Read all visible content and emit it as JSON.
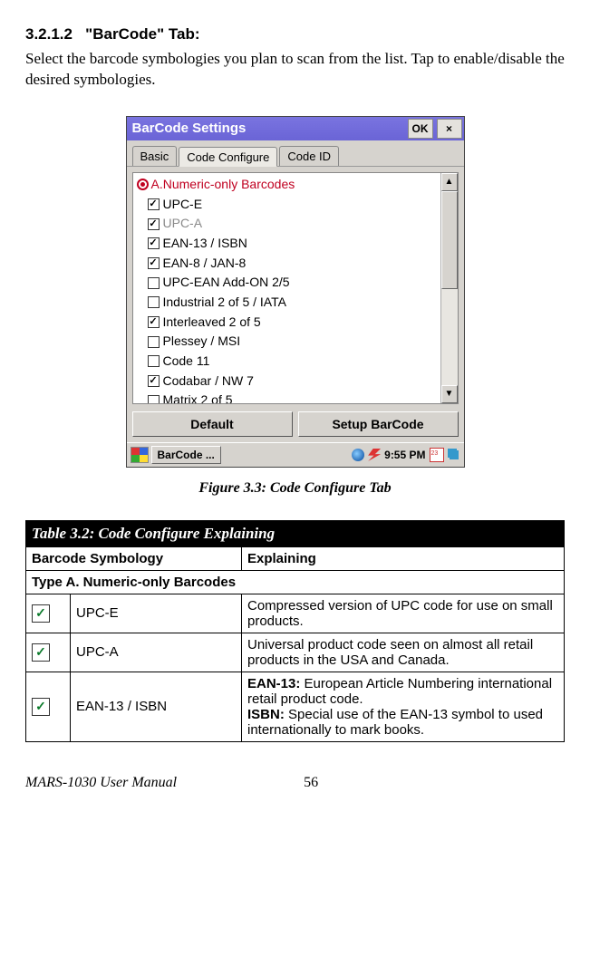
{
  "section": {
    "number": "3.2.1.2",
    "title": "\"BarCode\" Tab:",
    "body": "Select the barcode symbologies you plan to scan from the list. Tap to enable/disable the desired symbologies."
  },
  "screenshot": {
    "window_title": "BarCode Settings",
    "ok_label": "OK",
    "close_label": "×",
    "tabs": {
      "basic": "Basic",
      "code_configure": "Code Configure",
      "code_id": "Code ID"
    },
    "group_label": "A.Numeric-only Barcodes",
    "items": [
      {
        "label": "UPC-E",
        "checked": true,
        "disabled": false
      },
      {
        "label": "UPC-A",
        "checked": true,
        "disabled": true
      },
      {
        "label": "EAN-13 / ISBN",
        "checked": true,
        "disabled": false
      },
      {
        "label": "EAN-8 / JAN-8",
        "checked": true,
        "disabled": false
      },
      {
        "label": "UPC-EAN Add-ON 2/5",
        "checked": false,
        "disabled": false
      },
      {
        "label": "Industrial 2 of 5 / IATA",
        "checked": false,
        "disabled": false
      },
      {
        "label": "Interleaved 2 of 5",
        "checked": true,
        "disabled": false
      },
      {
        "label": "Plessey / MSI",
        "checked": false,
        "disabled": false
      },
      {
        "label": "Code 11",
        "checked": false,
        "disabled": false
      },
      {
        "label": "Codabar / NW 7",
        "checked": true,
        "disabled": false
      },
      {
        "label": "Matrix 2 of 5",
        "checked": false,
        "disabled": false
      }
    ],
    "buttons": {
      "default": "Default",
      "setup": "Setup BarCode"
    },
    "taskbar": {
      "app": "BarCode ...",
      "time": "9:55 PM"
    }
  },
  "figure_caption": "Figure 3.3: Code Configure Tab",
  "table": {
    "title": "Table 3.2: Code Configure Explaining",
    "headers": {
      "col1": "Barcode Symbology",
      "col2": "Explaining"
    },
    "type_row": "Type A. Numeric-only Barcodes",
    "rows": [
      {
        "name": "UPC-E",
        "explain": "Compressed version of UPC code for use on small products."
      },
      {
        "name": "UPC-A",
        "explain": "Universal product code seen on almost all retail products in the USA and Canada."
      },
      {
        "name": "EAN-13 / ISBN",
        "ean_label": "EAN-13:",
        "ean_text": " European Article Numbering international retail product code.",
        "isbn_label": "ISBN:",
        "isbn_text": " Special use of the EAN-13 symbol to used internationally to mark books."
      }
    ]
  },
  "footer": {
    "manual": "MARS-1030 User Manual",
    "page": "56"
  }
}
